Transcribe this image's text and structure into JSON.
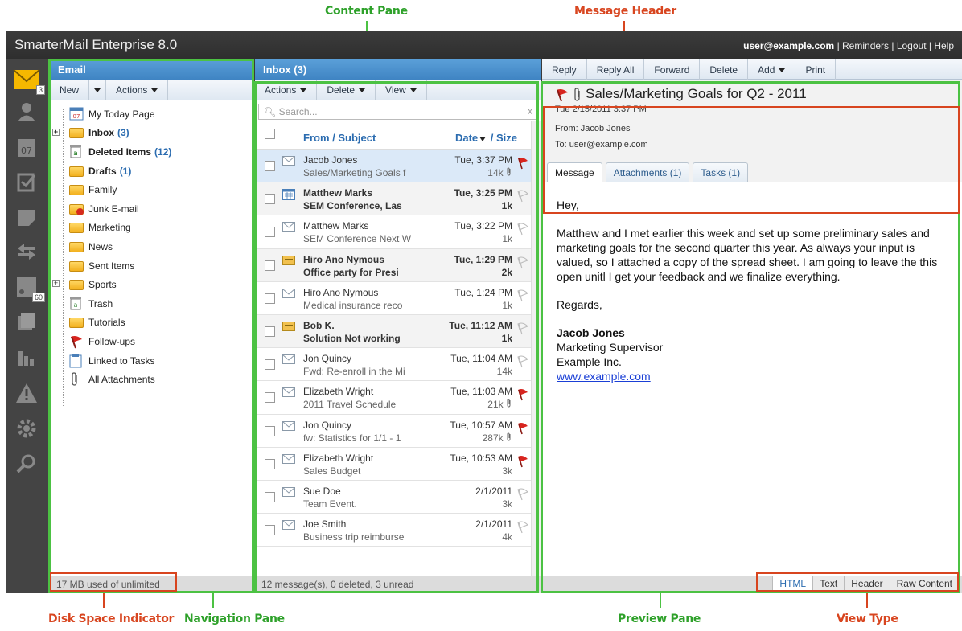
{
  "callouts": {
    "content_pane": "Content Pane",
    "message_header": "Message Header",
    "disk_space": "Disk Space Indicator",
    "navigation_pane": "Navigation Pane",
    "preview_pane": "Preview Pane",
    "view_type": "View Type"
  },
  "app": {
    "title": "SmarterMail Enterprise 8.0",
    "user": "user@example.com",
    "links": " | Reminders | Logout | Help"
  },
  "rail": {
    "email_badge": "3",
    "rss_badge": "60"
  },
  "nav": {
    "header": "Email",
    "toolbar": {
      "new": "New",
      "actions": "Actions"
    },
    "items": [
      {
        "label": "My Today Page",
        "count": ""
      },
      {
        "label": "Inbox",
        "count": "(3)"
      },
      {
        "label": "Deleted Items",
        "count": "(12)"
      },
      {
        "label": "Drafts",
        "count": "(1)"
      },
      {
        "label": "Family",
        "count": ""
      },
      {
        "label": "Junk E-mail",
        "count": ""
      },
      {
        "label": "Marketing",
        "count": ""
      },
      {
        "label": "News",
        "count": ""
      },
      {
        "label": "Sent Items",
        "count": ""
      },
      {
        "label": "Sports",
        "count": ""
      },
      {
        "label": "Trash",
        "count": ""
      },
      {
        "label": "Tutorials",
        "count": ""
      },
      {
        "label": "Follow-ups",
        "count": ""
      },
      {
        "label": "Linked to Tasks",
        "count": ""
      },
      {
        "label": "All Attachments",
        "count": ""
      }
    ],
    "status": "17 MB used of unlimited"
  },
  "content": {
    "header": "Inbox (3)",
    "toolbar": {
      "actions": "Actions",
      "delete": "Delete",
      "view": "View"
    },
    "search_placeholder": "Search...",
    "search_clear": "x",
    "col_from": "From / Subject",
    "col_date": "Date",
    "col_size": " / Size",
    "messages": [
      {
        "from": "Jacob Jones",
        "subject": "Sales/Marketing Goals f",
        "date": "Tue, 3:37 PM",
        "size": "14k"
      },
      {
        "from": "Matthew Marks",
        "subject": "SEM Conference, Las",
        "date": "Tue, 3:25 PM",
        "size": "1k"
      },
      {
        "from": "Matthew Marks",
        "subject": "SEM Conference Next W",
        "date": "Tue, 3:22 PM",
        "size": "1k"
      },
      {
        "from": "Hiro Ano Nymous",
        "subject": "Office party for Presi",
        "date": "Tue, 1:29 PM",
        "size": "2k"
      },
      {
        "from": "Hiro Ano Nymous",
        "subject": "Medical insurance reco",
        "date": "Tue, 1:24 PM",
        "size": "1k"
      },
      {
        "from": "Bob K.",
        "subject": "Solution Not working",
        "date": "Tue, 11:12 AM",
        "size": "1k"
      },
      {
        "from": "Jon Quincy",
        "subject": "Fwd: Re-enroll in the Mi",
        "date": "Tue, 11:04 AM",
        "size": "14k"
      },
      {
        "from": "Elizabeth Wright",
        "subject": "2011 Travel Schedule",
        "date": "Tue, 11:03 AM",
        "size": "21k"
      },
      {
        "from": "Jon Quincy",
        "subject": "fw: Statistics for 1/1 - 1",
        "date": "Tue, 10:57 AM",
        "size": "287k"
      },
      {
        "from": "Elizabeth Wright",
        "subject": "Sales Budget",
        "date": "Tue, 10:53 AM",
        "size": "3k"
      },
      {
        "from": "Sue Doe",
        "subject": "Team Event.",
        "date": "2/1/2011",
        "size": "3k"
      },
      {
        "from": "Joe Smith",
        "subject": "Business trip reimburse",
        "date": "2/1/2011",
        "size": "4k"
      }
    ],
    "status": "12 message(s), 0 deleted, 3 unread"
  },
  "preview": {
    "toolbar": {
      "reply": "Reply",
      "reply_all": "Reply All",
      "forward": "Forward",
      "delete": "Delete",
      "add": "Add",
      "print": "Print"
    },
    "subject": "Sales/Marketing Goals for Q2 - 2011",
    "date": "Tue 2/15/2011 3:37 PM",
    "from": "From:  Jacob Jones",
    "to": "To:  user@example.com",
    "tabs": {
      "message": "Message",
      "attachments": "Attachments (1)",
      "tasks": "Tasks (1)"
    },
    "body": {
      "greeting": "Hey,",
      "paragraph": "Matthew and I met earlier this week and set up some preliminary sales and marketing goals for the second quarter this year.  As always your input is valued, so I attached a copy of the spread sheet.  I am going to leave the this open unitl I get your feedback and we finalize everything.",
      "closing": "Regards,",
      "sig_name": "Jacob Jones",
      "sig_title": "Marketing Supervisor",
      "sig_company": "Example Inc.",
      "sig_link": "www.example.com"
    },
    "view_types": {
      "html": "HTML",
      "text": "Text",
      "header": "Header",
      "raw": "Raw Content"
    }
  },
  "colors": {
    "highlight_green": "#4cc243",
    "highlight_red": "#d8451f",
    "pane_header_blue": "#4a90cf",
    "flag_red": "#d8251f"
  }
}
